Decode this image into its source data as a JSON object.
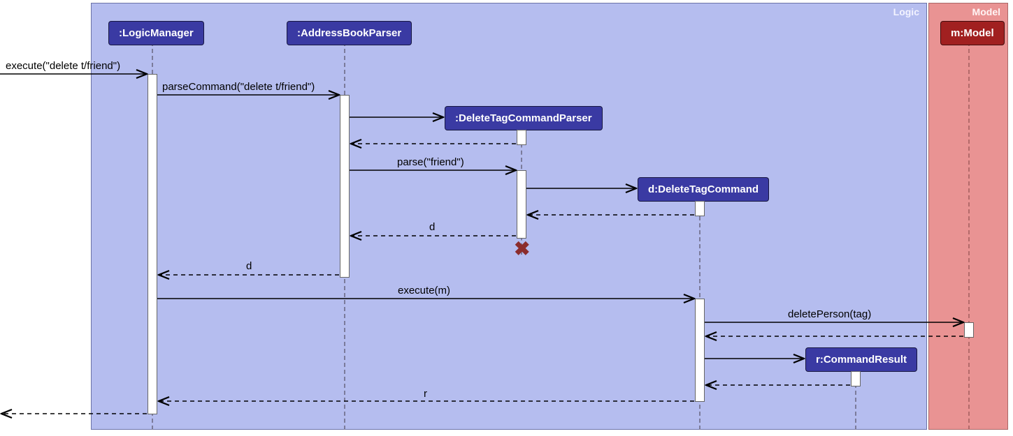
{
  "frames": {
    "logic": {
      "title": "Logic"
    },
    "model": {
      "title": "Model"
    }
  },
  "lifelines": {
    "logicManager": ":LogicManager",
    "addressBookParser": ":AddressBookParser",
    "deleteTagCommandParser": ":DeleteTagCommandParser",
    "deleteTagCommand": "d:DeleteTagCommand",
    "commandResult": "r:CommandResult",
    "model": "m:Model"
  },
  "messages": {
    "execute_in": "execute(\"delete t/friend\")",
    "parseCommand": "parseCommand(\"delete t/friend\")",
    "parse": "parse(\"friend\")",
    "return_d1": "d",
    "return_d2": "d",
    "execute_m": "execute(m)",
    "deletePerson": "deletePerson(tag)",
    "return_r": "r"
  }
}
